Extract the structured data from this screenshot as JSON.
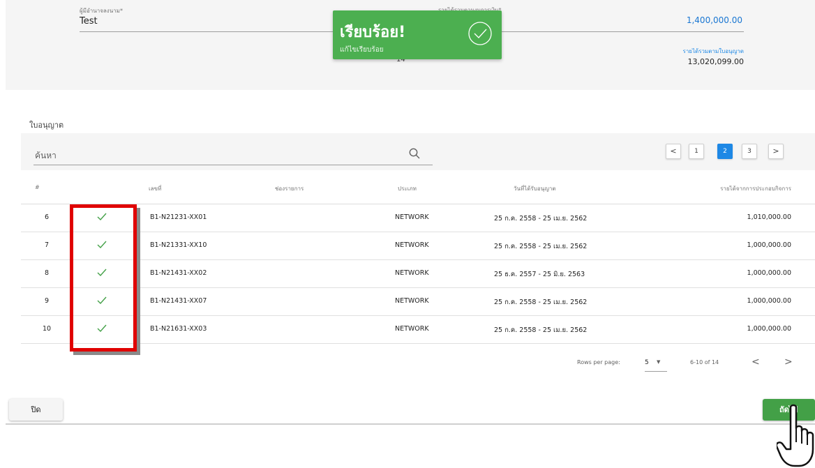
{
  "header": {
    "signer_label": "ผู้มีอำนาจลงนาม*",
    "signer_value": "Test",
    "income_label": "รายได้รวมตามงบการเงิน*",
    "income_value": "1,400,000.00",
    "total_label": "รายได้รวมตามใบอนุญาต",
    "total_value": "13,020,099.00",
    "count_value": "14"
  },
  "toast": {
    "title": "เรียบร้อย!",
    "subtitle": "แก้ไขเรียบร้อย",
    "icon": "check-circle-icon",
    "color": "#4caf50"
  },
  "section": {
    "title": "ใบอนุญาต"
  },
  "search": {
    "placeholder": "ค้นหา",
    "icon": "search-icon"
  },
  "pager": {
    "prev_label": "<",
    "next_label": ">",
    "pages": [
      "1",
      "2",
      "3"
    ],
    "active_page": "2",
    "accent": "#1e88e5"
  },
  "table": {
    "headers": {
      "num": "#",
      "number": "เลขที่",
      "channel": "ช่องรายการ",
      "type": "ประเภท",
      "date": "วันที่ได้รับอนุญาต",
      "income": "รายได้จากการประกอบกิจการ"
    },
    "check_glyph": "✓",
    "check_color": "#43a047",
    "rows": [
      {
        "num": "6",
        "license": "B1-N21231-XX01",
        "channel": "",
        "type": "NETWORK",
        "date": "25 ก.ค. 2558 - 25 เม.ย. 2562",
        "amount": "1,010,000.00",
        "checked": true
      },
      {
        "num": "7",
        "license": "B1-N21331-XX10",
        "channel": "",
        "type": "NETWORK",
        "date": "25 ก.ค. 2558 - 25 เม.ย. 2562",
        "amount": "1,000,000.00",
        "checked": true
      },
      {
        "num": "8",
        "license": "B1-N21431-XX02",
        "channel": "",
        "type": "NETWORK",
        "date": "25 ธ.ค. 2557 - 25 มิ.ย. 2563",
        "amount": "1,000,000.00",
        "checked": true
      },
      {
        "num": "9",
        "license": "B1-N21431-XX07",
        "channel": "",
        "type": "NETWORK",
        "date": "25 ก.ค. 2558 - 25 เม.ย. 2562",
        "amount": "1,000,000.00",
        "checked": true
      },
      {
        "num": "10",
        "license": "B1-N21631-XX03",
        "channel": "",
        "type": "NETWORK",
        "date": "25 ก.ค. 2558 - 25 เม.ย. 2562",
        "amount": "1,000,000.00",
        "checked": true
      }
    ]
  },
  "footer": {
    "rows_per_page_label": "Rows per page:",
    "rows_per_page_value": "5",
    "range_text": "6-10 of 14",
    "prev": "<",
    "next": ">"
  },
  "actions": {
    "close_label": "ปิด",
    "next_label": "ถัดไป",
    "next_color": "#43a047"
  },
  "annotation": {
    "highlight_color": "#e00000",
    "cursor": "hand-pointer-icon"
  }
}
